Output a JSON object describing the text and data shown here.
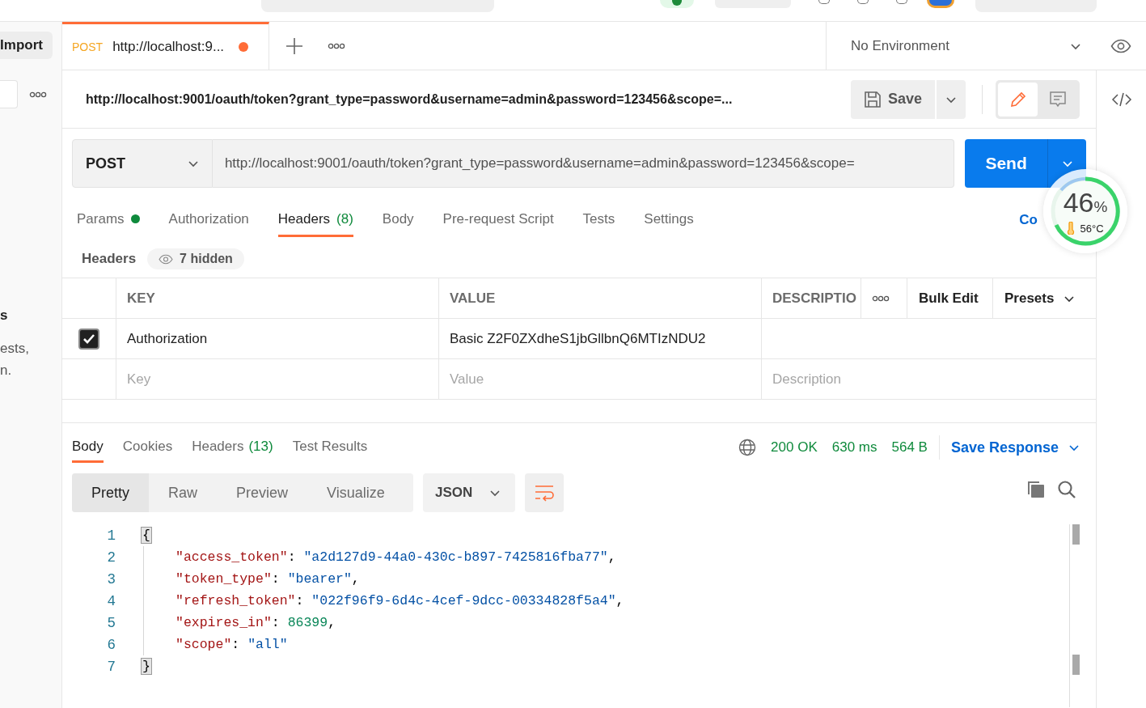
{
  "sidebar": {
    "import_button": "Import",
    "fragments": [
      {
        "kind": "heading",
        "text": "s"
      },
      {
        "kind": "body",
        "text": "ests,"
      },
      {
        "kind": "body",
        "text": "n."
      }
    ]
  },
  "tabs": [
    {
      "method": "POST",
      "title": "http://localhost:9...",
      "unsaved": true,
      "selected": true
    }
  ],
  "environment": {
    "value": "No Environment"
  },
  "request": {
    "title": "http://localhost:9001/oauth/token?grant_type=password&username=admin&password=123456&scope=...",
    "save_label": "Save",
    "view_modes": [
      {
        "kind": "edit",
        "selected": true
      },
      {
        "kind": "comments",
        "selected": false
      }
    ]
  },
  "url_bar": {
    "method": "POST",
    "url": "http://localhost:9001/oauth/token?grant_type=password&username=admin&password=123456&scope=",
    "send_label": "Send"
  },
  "request_tabs": [
    {
      "label": "Params",
      "dot": true,
      "selected": false
    },
    {
      "label": "Authorization",
      "selected": false
    },
    {
      "label": "Headers",
      "count": "(8)",
      "selected": true
    },
    {
      "label": "Body",
      "selected": false
    },
    {
      "label": "Pre-request Script",
      "selected": false
    },
    {
      "label": "Tests",
      "selected": false
    },
    {
      "label": "Settings",
      "selected": false
    }
  ],
  "cookies_link": "Co",
  "headers_bar": {
    "title": "Headers",
    "hidden_label": "7 hidden"
  },
  "headers_table": {
    "columns": [
      "KEY",
      "VALUE",
      "DESCRIPTIO"
    ],
    "bulk_edit": "Bulk Edit",
    "presets": "Presets",
    "rows": [
      {
        "checked": true,
        "key": "Authorization",
        "value": "Basic Z2F0ZXdheS1jbGllbnQ6MTIzNDU2"
      }
    ],
    "new_row": {
      "key_placeholder": "Key",
      "value_placeholder": "Value",
      "description_placeholder": "Description"
    }
  },
  "response": {
    "tabs": [
      {
        "label": "Body",
        "selected": true
      },
      {
        "label": "Cookies",
        "selected": false
      },
      {
        "label": "Headers",
        "count": "(13)",
        "selected": false
      },
      {
        "label": "Test Results",
        "selected": false
      }
    ],
    "status": "200 OK",
    "time": "630 ms",
    "size": "564 B",
    "save_label": "Save Response",
    "views": [
      {
        "label": "Pretty",
        "selected": true
      },
      {
        "label": "Raw",
        "selected": false
      },
      {
        "label": "Preview",
        "selected": false
      },
      {
        "label": "Visualize",
        "selected": false
      }
    ],
    "format": "JSON",
    "line_wrap": true,
    "code_lines": [
      {
        "number": "1",
        "tokens": [
          {
            "kind": "bracket",
            "text": "{"
          }
        ],
        "children": [
          {
            "number": "2",
            "tokens": [
              {
                "kind": "key",
                "text": "\"access_token\""
              },
              {
                "kind": "punct",
                "text": ": "
              },
              {
                "kind": "string",
                "text": "\"a2d127d9-44a0-430c-b897-7425816fba77\""
              },
              {
                "kind": "punct",
                "text": ","
              }
            ]
          },
          {
            "number": "3",
            "tokens": [
              {
                "kind": "key",
                "text": "\"token_type\""
              },
              {
                "kind": "punct",
                "text": ": "
              },
              {
                "kind": "string",
                "text": "\"bearer\""
              },
              {
                "kind": "punct",
                "text": ","
              }
            ]
          },
          {
            "number": "4",
            "tokens": [
              {
                "kind": "key",
                "text": "\"refresh_token\""
              },
              {
                "kind": "punct",
                "text": ": "
              },
              {
                "kind": "string",
                "text": "\"022f96f9-6d4c-4cef-9dcc-00334828f5a4\""
              },
              {
                "kind": "punct",
                "text": ","
              }
            ]
          },
          {
            "number": "5",
            "tokens": [
              {
                "kind": "key",
                "text": "\"expires_in\""
              },
              {
                "kind": "punct",
                "text": ": "
              },
              {
                "kind": "number",
                "text": "86399"
              },
              {
                "kind": "punct",
                "text": ","
              }
            ]
          },
          {
            "number": "6",
            "tokens": [
              {
                "kind": "key",
                "text": "\"scope\""
              },
              {
                "kind": "punct",
                "text": ": "
              },
              {
                "kind": "string",
                "text": "\"all\""
              }
            ]
          }
        ]
      },
      {
        "number": "7",
        "tokens": [
          {
            "kind": "bracket",
            "text": "}"
          }
        ]
      }
    ]
  },
  "monitor": {
    "value": "46",
    "unit": "%",
    "temperature": "56°C"
  }
}
